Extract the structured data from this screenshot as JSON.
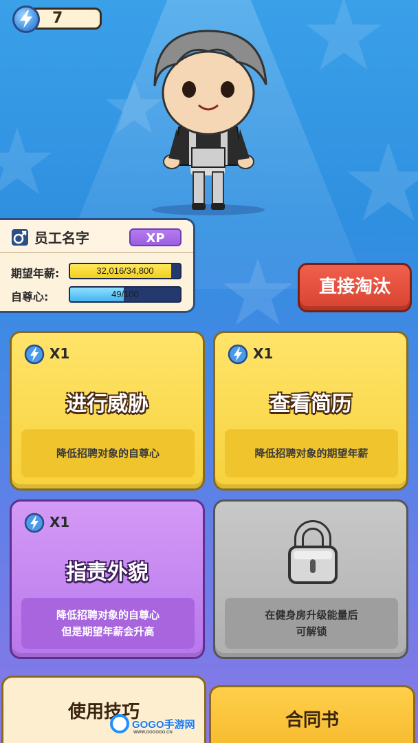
{
  "hud": {
    "energy_count": "7"
  },
  "employee": {
    "name": "员工名字",
    "xp_label": "XP",
    "salary_label": "期望年薪:",
    "salary_value": "32,016/34,800",
    "salary_progress": 0.92,
    "esteem_label": "自尊心:",
    "esteem_value": "49/100",
    "esteem_progress": 0.49
  },
  "actions": {
    "eliminate_label": "直接淘汰",
    "cards": [
      {
        "cost": "X1",
        "title": "进行威胁",
        "desc": [
          "降低招聘对象的自尊心"
        ]
      },
      {
        "cost": "X1",
        "title": "查看简历",
        "desc": [
          "降低招聘对象的期望年薪"
        ]
      },
      {
        "cost": "X1",
        "title": "指责外貌",
        "desc": [
          "降低招聘对象的自尊心",
          "但是期望年薪会升高"
        ]
      },
      {
        "locked": true,
        "desc": [
          "在健身房升级能量后",
          "可解锁"
        ]
      }
    ]
  },
  "tabs": {
    "skills": "使用技巧",
    "contract": "合同书"
  },
  "watermark": {
    "text": "GOGO手游网",
    "sub": "WWW.GOGOGO.CN"
  },
  "colors": {
    "accent_red": "#e0513c",
    "card_yellow": "#f7d23c",
    "card_purple": "#b877ec",
    "locked_gray": "#b0b0b0"
  }
}
